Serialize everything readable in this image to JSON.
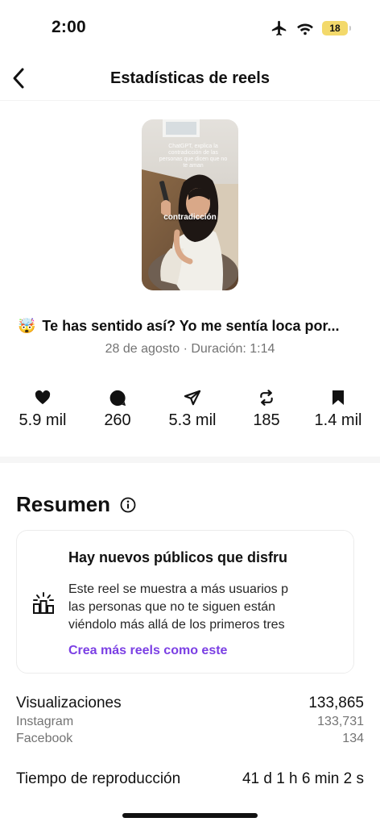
{
  "status_bar": {
    "time": "2:00",
    "battery": "18"
  },
  "nav": {
    "title": "Estadísticas de reels"
  },
  "thumbnail": {
    "caption": "ChatGPT, explica la contradicción de las personas que dicen que no te aman",
    "overlay_word": "contradicción"
  },
  "reel": {
    "emoji": "🤯",
    "title": "Te has sentido así? Yo me sentía loca por...",
    "meta": "28 de agosto · Duración: 1:14"
  },
  "stats": {
    "likes": "5.9 mil",
    "comments": "260",
    "shares": "5.3 mil",
    "reposts": "185",
    "saves": "1.4 mil"
  },
  "summary": {
    "title": "Resumen",
    "card": {
      "heading": "Hay nuevos públicos que disfru",
      "line1": "Este reel se muestra a más usuarios p",
      "line2": "las personas que no te siguen están",
      "line3": "viéndolo más allá de los primeros tres",
      "cta": "Crea más reels como este"
    }
  },
  "metrics": {
    "views_label": "Visualizaciones",
    "views_value": "133,865",
    "instagram_label": "Instagram",
    "instagram_value": "133,731",
    "facebook_label": "Facebook",
    "facebook_value": "134",
    "playtime_label": "Tiempo de reproducción",
    "playtime_value": "41 d 1 h 6 min 2 s"
  },
  "colors": {
    "accent_link": "#7b3fe4",
    "battery": "#f3d96b",
    "muted_text": "#737373"
  },
  "icons": [
    "airplane-icon",
    "wifi-icon",
    "battery-icon",
    "back-chevron-icon",
    "heart-icon",
    "comment-icon",
    "share-icon",
    "repost-icon",
    "bookmark-icon",
    "info-icon",
    "audience-icon"
  ]
}
